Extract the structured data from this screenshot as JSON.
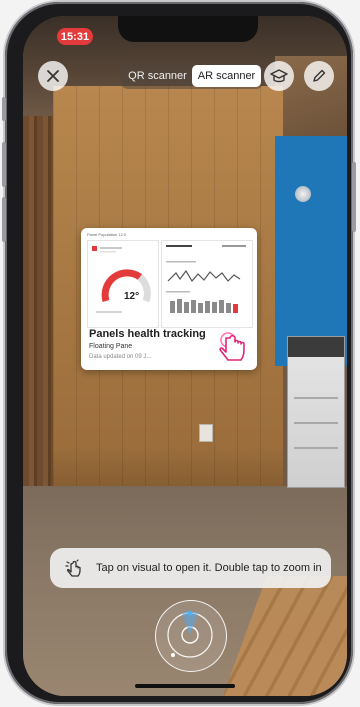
{
  "status_bar": {
    "time": "15:31"
  },
  "toolbar": {
    "close_icon": "close-icon",
    "modes": [
      {
        "label": "QR scanner",
        "active": false
      },
      {
        "label": "AR scanner",
        "active": true
      }
    ],
    "learn_icon": "graduation-cap-icon",
    "edit_icon": "pencil-icon"
  },
  "card": {
    "header": "Panel Population 12.0",
    "gauge_value": "12°",
    "title": "Panels health tracking",
    "subtitle": "Floating Pane",
    "date": "Data updated on 09 J..."
  },
  "hint": {
    "icon": "tap-gesture-icon",
    "text": "Tap on visual to open it. Double tap to zoom in"
  },
  "radar": {
    "icon": "radar-icon"
  },
  "colors": {
    "accent_red": "#e33b3b",
    "pill_bg": "#ffffff"
  }
}
